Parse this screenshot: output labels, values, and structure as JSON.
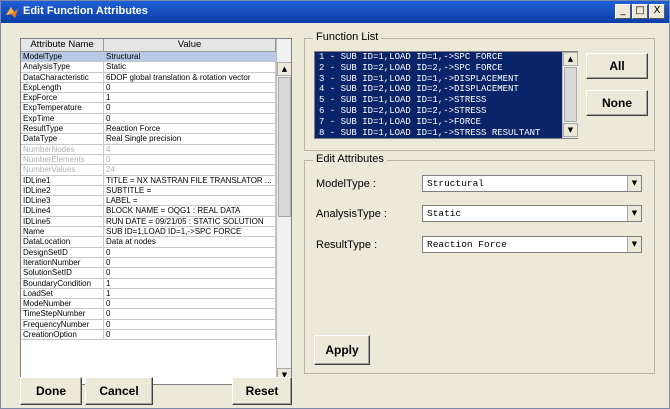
{
  "window": {
    "title": "Edit Function Attributes",
    "controls": {
      "minimize": "_",
      "maximize": "□",
      "close": "X"
    }
  },
  "table": {
    "headers": [
      "Attribute Name",
      "Value"
    ],
    "rows": [
      {
        "name": "ModelType",
        "value": "Structural",
        "selected": true
      },
      {
        "name": "AnalysisType",
        "value": "Static"
      },
      {
        "name": "DataCharacteristic",
        "value": "6DOF global translation & rotation vector"
      },
      {
        "name": "ExpLength",
        "value": "0"
      },
      {
        "name": "ExpForce",
        "value": "1"
      },
      {
        "name": "ExpTemperature",
        "value": "0"
      },
      {
        "name": "ExpTime",
        "value": "0"
      },
      {
        "name": "ResultType",
        "value": "Reaction Force"
      },
      {
        "name": "DataType",
        "value": "Real Single precision"
      },
      {
        "name": "NumberNodes",
        "value": "4",
        "disabled": true
      },
      {
        "name": "NumberElements",
        "value": "0",
        "disabled": true
      },
      {
        "name": "NumberValues",
        "value": "24",
        "disabled": true
      },
      {
        "name": "IDLine1",
        "value": "TITLE  = NX  NASTRAN FILE TRANSLATOR  ..."
      },
      {
        "name": "IDLine2",
        "value": "SUBTITLE ="
      },
      {
        "name": "IDLine3",
        "value": "LABEL  ="
      },
      {
        "name": "IDLine4",
        "value": "BLOCK NAME  = OQG1    : REAL DATA"
      },
      {
        "name": "IDLine5",
        "value": "RUN DATE    = 09/21/05 : STATIC SOLUTION"
      },
      {
        "name": "Name",
        "value": "SUB ID=1,LOAD ID=1,->SPC FORCE"
      },
      {
        "name": "DataLocation",
        "value": "Data at nodes"
      },
      {
        "name": "DesignSetID",
        "value": "0"
      },
      {
        "name": "IterationNumber",
        "value": "0"
      },
      {
        "name": "SolutionSetID",
        "value": "0"
      },
      {
        "name": "BoundaryCondition",
        "value": "1"
      },
      {
        "name": "LoadSet",
        "value": "1"
      },
      {
        "name": "ModeNumber",
        "value": "0"
      },
      {
        "name": "TimeStepNumber",
        "value": "0"
      },
      {
        "name": "FrequencyNumber",
        "value": "0"
      },
      {
        "name": "CreationOption",
        "value": "0"
      }
    ]
  },
  "function_list": {
    "label": "Function List",
    "items": [
      "1 - SUB ID=1,LOAD ID=1,->SPC FORCE",
      "2 - SUB ID=2,LOAD ID=2,->SPC FORCE",
      "3 - SUB ID=1,LOAD ID=1,->DISPLACEMENT",
      "4 - SUB ID=2,LOAD ID=2,->DISPLACEMENT",
      "5 - SUB ID=1,LOAD ID=1,->STRESS",
      "6 - SUB ID=2,LOAD ID=2,->STRESS",
      "7 - SUB ID=1,LOAD ID=1,->FORCE",
      "8 - SUB ID=1,LOAD ID=1,->STRESS RESULTANT"
    ],
    "all_label": "All",
    "none_label": "None"
  },
  "edit_attributes": {
    "label": "Edit Attributes",
    "model_type_label": "ModelType :",
    "model_type_value": "Structural",
    "analysis_type_label": "AnalysisType :",
    "analysis_type_value": "Static",
    "result_type_label": "ResultType :",
    "result_type_value": "Reaction Force",
    "apply_label": "Apply"
  },
  "footer": {
    "done_label": "Done",
    "cancel_label": "Cancel",
    "reset_label": "Reset"
  }
}
